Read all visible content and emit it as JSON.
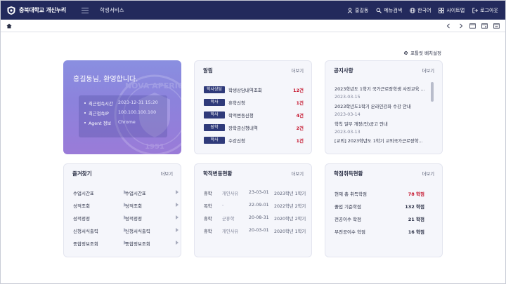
{
  "header": {
    "logo_text": "충북대학교 개신누리",
    "section_title": "학생서비스",
    "actions": [
      {
        "icon": "user-icon",
        "label": "홍길동"
      },
      {
        "icon": "search-icon",
        "label": "메뉴검색"
      },
      {
        "icon": "globe-icon",
        "label": "한국어"
      },
      {
        "icon": "sitemap-icon",
        "label": "사이트맵"
      },
      {
        "icon": "logout-icon",
        "label": "로그아웃"
      }
    ]
  },
  "portlet_setting": "포틀릿 배치설정",
  "more_label": "더보기",
  "welcome": {
    "title": "홍길동님, 환영합니다.",
    "watermark": "NOVA APERIO 1951",
    "info": [
      {
        "key": "최근접속시간",
        "value": "2023-12-31 15:20"
      },
      {
        "key": "최근접속IP",
        "value": "100.100.100.100"
      },
      {
        "key": "Agent 정보",
        "value": "Chrome"
      }
    ]
  },
  "alarm": {
    "title": "알림",
    "rows": [
      {
        "tag": "학사상담",
        "label": "학생상담내역조회",
        "count": "12건"
      },
      {
        "tag": "학사",
        "label": "휴학신청",
        "count": "1건"
      },
      {
        "tag": "학사",
        "label": "학적변동신청",
        "count": "4건"
      },
      {
        "tag": "장학",
        "label": "장학금신청내역",
        "count": "2건"
      },
      {
        "tag": "학사",
        "label": "수강신청",
        "count": "1건"
      }
    ]
  },
  "notice": {
    "title": "공지사항",
    "items": [
      {
        "title": "2023학년도 1학기 국가근로장학생 사전교육 ...",
        "date": "2023-03-15"
      },
      {
        "title": "2023학년도1학기 온라인강좌 수강 안내",
        "date": "2023-03-14"
      },
      {
        "title": "학칙 일부 개정(안)공고 안내",
        "date": "2023-03-13"
      },
      {
        "title": "[교외] 2023학년도 1학기 교외국가근로장학...",
        "date": ""
      }
    ]
  },
  "favorites": {
    "title": "즐겨찾기",
    "left": [
      "수업시간표",
      "성적조회",
      "성적정정",
      "신청서식출력",
      "종합정보조회"
    ],
    "right": [
      "수업시간표",
      "성적조회",
      "성적정정",
      "신청서식출력",
      "종합정보조회"
    ]
  },
  "change_status": {
    "title": "학적변동현황",
    "rows": [
      {
        "type": "휴학",
        "reason": "개인사유",
        "date": "23-03-01",
        "term": "2023학년 1학기"
      },
      {
        "type": "복학",
        "reason": "-",
        "date": "22-09-01",
        "term": "2022학년 2학기"
      },
      {
        "type": "휴학",
        "reason": "군휴학",
        "date": "20-08-31",
        "term": "2020학년 2학기"
      },
      {
        "type": "휴학",
        "reason": "개인사유",
        "date": "20-03-01",
        "term": "2020학년 1학기"
      }
    ]
  },
  "credits": {
    "title": "학점취득현황",
    "rows": [
      {
        "label": "현재 총 취득학점",
        "value": "78 학점",
        "highlight": true
      },
      {
        "label": "졸업 기준학점",
        "value": "132 학점",
        "highlight": false
      },
      {
        "label": "전공이수 학점",
        "value": "21 학점",
        "highlight": false
      },
      {
        "label": "부전공이수 학점",
        "value": "16 학점",
        "highlight": false
      }
    ]
  }
}
